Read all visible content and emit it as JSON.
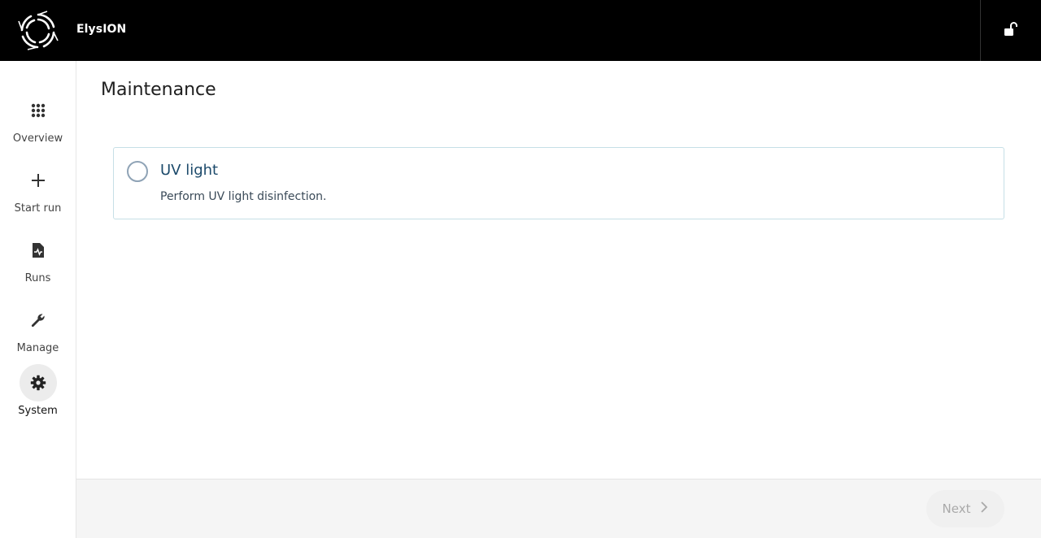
{
  "app": {
    "title": "ElysION"
  },
  "header": {
    "lock_icon": "unlock-icon"
  },
  "sidebar": {
    "items": [
      {
        "label": "Overview",
        "icon": "grid-icon",
        "active": false
      },
      {
        "label": "Start run",
        "icon": "plus-icon",
        "active": false
      },
      {
        "label": "Runs",
        "icon": "report-icon",
        "active": false
      },
      {
        "label": "Manage",
        "icon": "wrench-icon",
        "active": false
      },
      {
        "label": "System",
        "icon": "gear-icon",
        "active": true
      }
    ]
  },
  "main": {
    "title": "Maintenance",
    "options": [
      {
        "title": "UV light",
        "description": "Perform UV light disinfection.",
        "selected": false
      }
    ]
  },
  "footer": {
    "next_label": "Next",
    "next_enabled": false
  },
  "colors": {
    "topbar": "#000000",
    "accent_text": "#1c4a6b",
    "card_border": "#c6dfe6"
  }
}
